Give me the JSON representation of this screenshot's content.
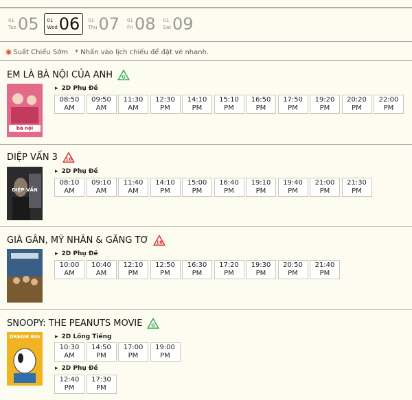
{
  "dates": [
    {
      "num": "01",
      "wd": "Tue",
      "day": "05",
      "selected": false
    },
    {
      "num": "01",
      "wd": "Wed",
      "day": "06",
      "selected": true
    },
    {
      "num": "01",
      "wd": "Thu",
      "day": "07",
      "selected": false
    },
    {
      "num": "01",
      "wd": "Fri",
      "day": "08",
      "selected": false
    },
    {
      "num": "01",
      "wd": "Sat",
      "day": "09",
      "selected": false
    }
  ],
  "legend": {
    "early": "Suất Chiếu Sớm",
    "note": "* Nhấn vào lịch chiếu để đặt vé nhanh."
  },
  "movies": [
    {
      "title": "EM LÀ BÀ NỘI CỦA ANH",
      "rating": "G",
      "rating_color": "#2fa84f",
      "poster_bg": "#e46a8a",
      "poster_text": "bà nội",
      "groups": [
        {
          "format": "2D Phụ Đề",
          "times": [
            [
              "08:50",
              "AM"
            ],
            [
              "09:50",
              "AM"
            ],
            [
              "11:30",
              "AM"
            ],
            [
              "12:30",
              "PM"
            ],
            [
              "14:10",
              "PM"
            ],
            [
              "15:10",
              "PM"
            ],
            [
              "16:50",
              "PM"
            ],
            [
              "17:50",
              "PM"
            ],
            [
              "19:20",
              "PM"
            ],
            [
              "20:20",
              "PM"
            ],
            [
              "22:00",
              "PM"
            ]
          ]
        }
      ]
    },
    {
      "title": "DIỆP VẤN 3",
      "rating": "16",
      "rating_color": "#d9302c",
      "poster_bg": "#444448",
      "poster_text": "DIỆP VẤN",
      "groups": [
        {
          "format": "2D Phụ Đề",
          "times": [
            [
              "08:10",
              "AM"
            ],
            [
              "09:10",
              "AM"
            ],
            [
              "11:40",
              "AM"
            ],
            [
              "14:10",
              "PM"
            ],
            [
              "15:00",
              "PM"
            ],
            [
              "16:40",
              "PM"
            ],
            [
              "19:10",
              "PM"
            ],
            [
              "19:40",
              "PM"
            ],
            [
              "21:00",
              "PM"
            ],
            [
              "21:30",
              "PM"
            ]
          ]
        }
      ]
    },
    {
      "title": "GIÀ GÂN, MỸ NHÂN & GĂNG TƠ",
      "rating": "16",
      "rating_color": "#d9302c",
      "poster_bg": "#3a5f86",
      "poster_text": "",
      "groups": [
        {
          "format": "2D Phụ Đề",
          "times": [
            [
              "10:00",
              "AM"
            ],
            [
              "10:40",
              "AM"
            ],
            [
              "12:10",
              "PM"
            ],
            [
              "12:50",
              "PM"
            ],
            [
              "16:30",
              "PM"
            ],
            [
              "17:20",
              "PM"
            ],
            [
              "19:30",
              "PM"
            ],
            [
              "20:50",
              "PM"
            ],
            [
              "21:40",
              "PM"
            ]
          ]
        }
      ]
    },
    {
      "title": "SNOOPY: THE PEANUTS MOVIE",
      "rating": "G",
      "rating_color": "#2fa84f",
      "poster_bg": "#f2b323",
      "poster_text": "DREAM BIG",
      "groups": [
        {
          "format": "2D Lồng Tiếng",
          "times": [
            [
              "10:30",
              "AM"
            ],
            [
              "14:50",
              "PM"
            ],
            [
              "17:00",
              "PM"
            ],
            [
              "19:00",
              "PM"
            ]
          ]
        },
        {
          "format": "2D Phụ Đề",
          "times": [
            [
              "12:40",
              "PM"
            ],
            [
              "17:30",
              "PM"
            ]
          ]
        }
      ]
    }
  ]
}
